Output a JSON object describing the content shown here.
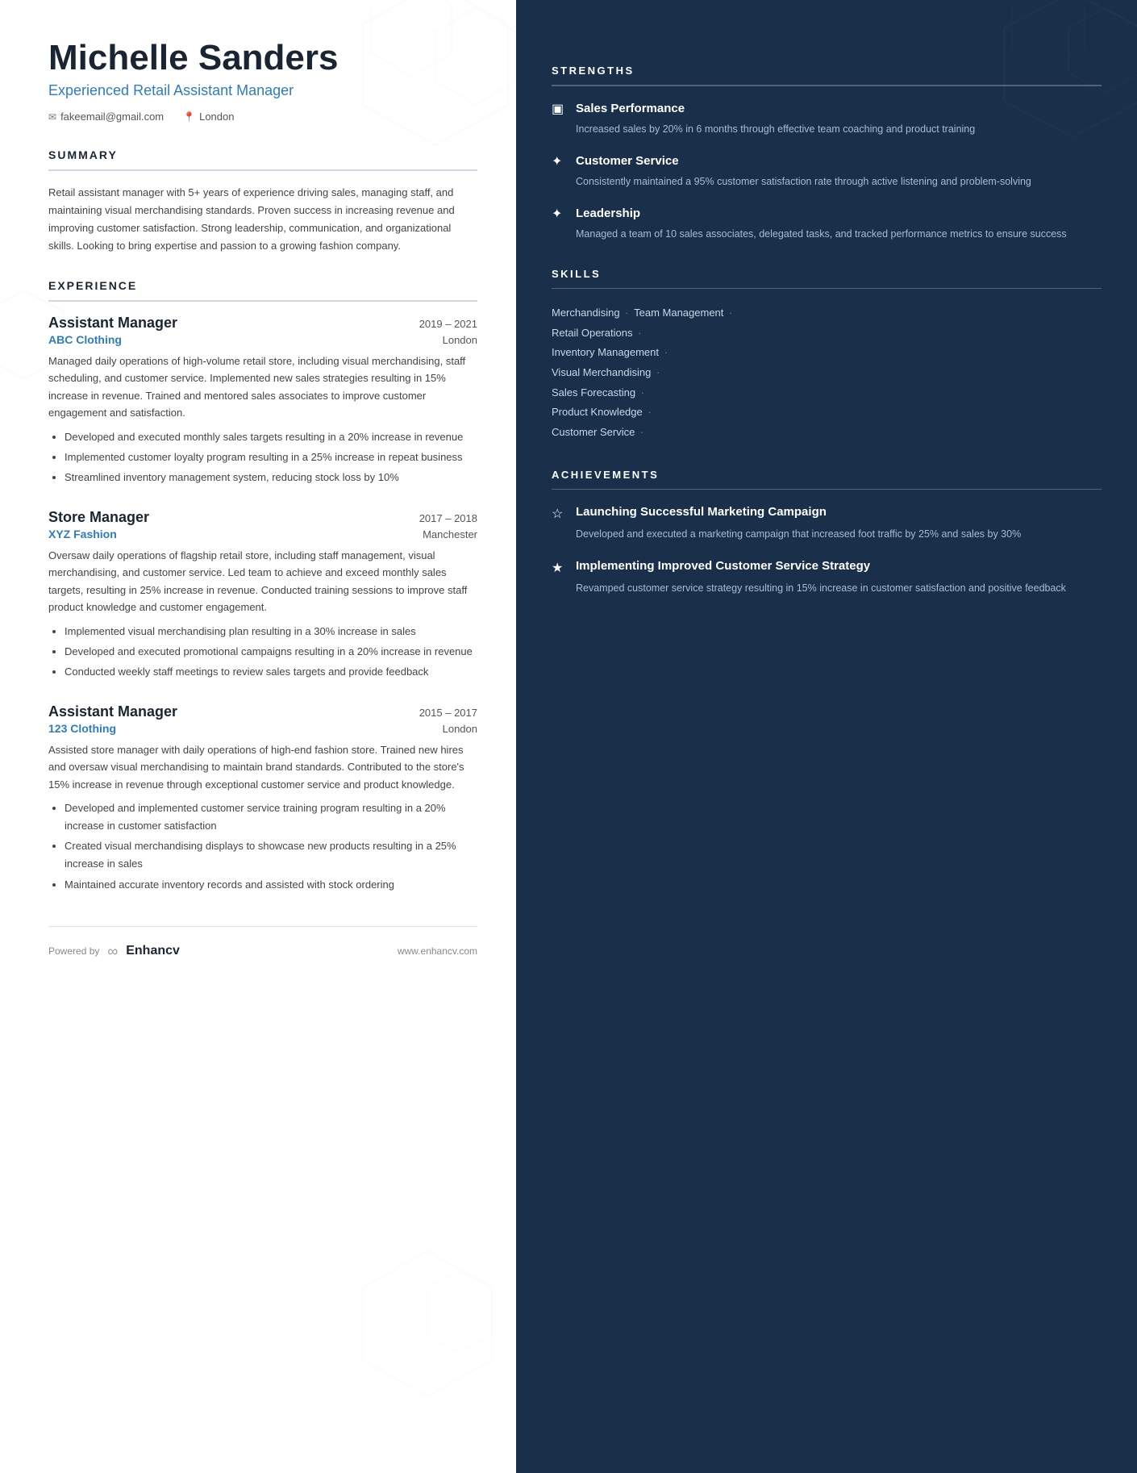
{
  "header": {
    "name": "Michelle Sanders",
    "title": "Experienced Retail Assistant Manager",
    "email": "fakeemail@gmail.com",
    "location": "London"
  },
  "summary": {
    "section_title": "SUMMARY",
    "text": "Retail assistant manager with 5+ years of experience driving sales, managing staff, and maintaining visual merchandising standards. Proven success in increasing revenue and improving customer satisfaction. Strong leadership, communication, and organizational skills. Looking to bring expertise and passion to a growing fashion company."
  },
  "experience": {
    "section_title": "EXPERIENCE",
    "jobs": [
      {
        "role": "Assistant Manager",
        "company": "ABC Clothing",
        "dates": "2019 – 2021",
        "location": "London",
        "description": "Managed daily operations of high-volume retail store, including visual merchandising, staff scheduling, and customer service. Implemented new sales strategies resulting in 15% increase in revenue. Trained and mentored sales associates to improve customer engagement and satisfaction.",
        "bullets": [
          "Developed and executed monthly sales targets resulting in a 20% increase in revenue",
          "Implemented customer loyalty program resulting in a 25% increase in repeat business",
          "Streamlined inventory management system, reducing stock loss by 10%"
        ]
      },
      {
        "role": "Store Manager",
        "company": "XYZ Fashion",
        "dates": "2017 – 2018",
        "location": "Manchester",
        "description": "Oversaw daily operations of flagship retail store, including staff management, visual merchandising, and customer service. Led team to achieve and exceed monthly sales targets, resulting in 25% increase in revenue. Conducted training sessions to improve staff product knowledge and customer engagement.",
        "bullets": [
          "Implemented visual merchandising plan resulting in a 30% increase in sales",
          "Developed and executed promotional campaigns resulting in a 20% increase in revenue",
          "Conducted weekly staff meetings to review sales targets and provide feedback"
        ]
      },
      {
        "role": "Assistant Manager",
        "company": "123 Clothing",
        "dates": "2015 – 2017",
        "location": "London",
        "description": "Assisted store manager with daily operations of high-end fashion store. Trained new hires and oversaw visual merchandising to maintain brand standards. Contributed to the store's 15% increase in revenue through exceptional customer service and product knowledge.",
        "bullets": [
          "Developed and implemented customer service training program resulting in a 20% increase in customer satisfaction",
          "Created visual merchandising displays to showcase new products resulting in a 25% increase in sales",
          "Maintained accurate inventory records and assisted with stock ordering"
        ]
      }
    ]
  },
  "strengths": {
    "section_title": "STRENGTHS",
    "items": [
      {
        "icon": "📊",
        "name": "Sales Performance",
        "desc": "Increased sales by 20% in 6 months through effective team coaching and product training"
      },
      {
        "icon": "🔧",
        "name": "Customer Service",
        "desc": "Consistently maintained a 95% customer satisfaction rate through active listening and problem-solving"
      },
      {
        "icon": "🔧",
        "name": "Leadership",
        "desc": "Managed a team of 10 sales associates, delegated tasks, and tracked performance metrics to ensure success"
      }
    ]
  },
  "skills": {
    "section_title": "SKILLS",
    "items": [
      "Merchandising",
      "Team Management",
      "Retail Operations",
      "Inventory Management",
      "Visual Merchandising",
      "Sales Forecasting",
      "Product Knowledge",
      "Customer Service"
    ]
  },
  "achievements": {
    "section_title": "ACHIEVEMENTS",
    "items": [
      {
        "icon": "☆",
        "name": "Launching Successful Marketing Campaign",
        "desc": "Developed and executed a marketing campaign that increased foot traffic by 25% and sales by 30%"
      },
      {
        "icon": "★",
        "name": "Implementing Improved Customer Service Strategy",
        "desc": "Revamped customer service strategy resulting in 15% increase in customer satisfaction and positive feedback"
      }
    ]
  },
  "footer": {
    "powered_by": "Powered by",
    "logo": "Enhancv",
    "website": "www.enhancv.com"
  }
}
